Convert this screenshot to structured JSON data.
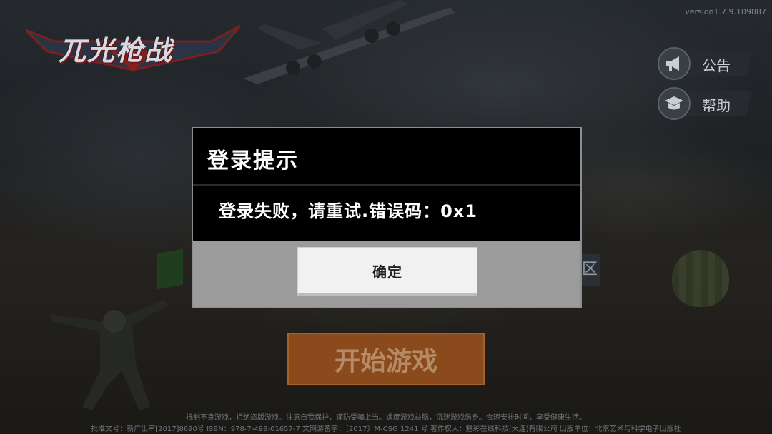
{
  "app": {
    "logo_text": "兀光枪战",
    "version": "version1.7.9.109887"
  },
  "side_buttons": [
    {
      "label": "公告",
      "icon": "megaphone-icon"
    },
    {
      "label": "帮助",
      "icon": "graduation-cap-icon"
    }
  ],
  "zone_tab": {
    "label": "区"
  },
  "start_button": {
    "label": "开始游戏"
  },
  "footer": {
    "line1": "抵制不良游戏，拒绝盗版游戏。注意自我保护，谨防受骗上当。适度游戏益脑，沉迷游戏伤身。合理安排时间，享受健康生活。",
    "line2": "批准文号：新广出审[2017]8690号    ISBN：978-7-498-01657-7    文网游备字：〔2017〕M-CSG 1241 号    著作权人：魅彩在线科技(大连)有限公司    出版单位：北京艺术与科学电子出版社"
  },
  "dialog": {
    "title": "登录提示",
    "message": "登录失败，请重试.错误码：0x1",
    "confirm_label": "确定"
  },
  "colors": {
    "dialog_bg": "#000000",
    "dialog_footer": "#9b9b9b",
    "confirm_button": "#f1f1f1",
    "start_button": "#8a4a1c"
  }
}
